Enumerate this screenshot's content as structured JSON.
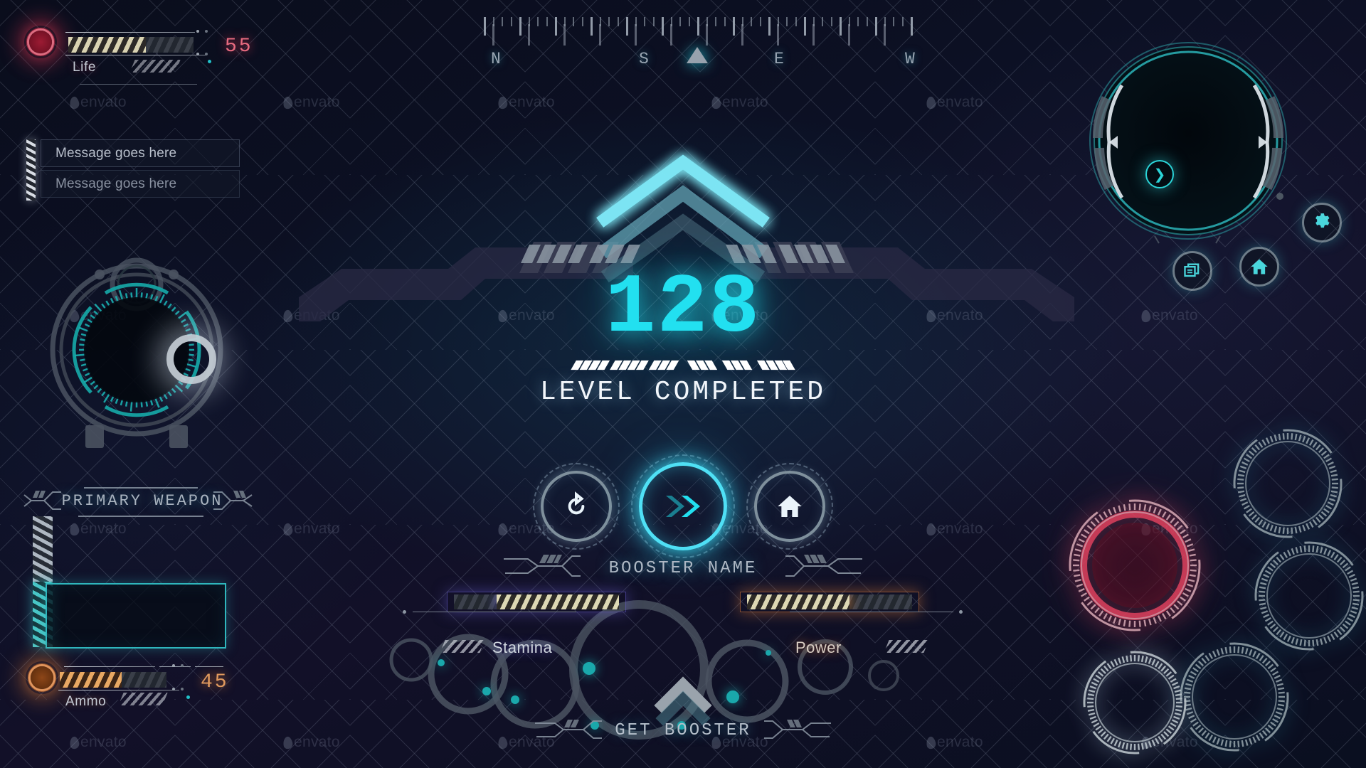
{
  "theme": {
    "bg": "#0a0d1c",
    "cyan": "#22e0f0",
    "teal": "#2fb6bd",
    "red": "#e23a55",
    "orange": "#e2803a",
    "purple": "#6a5fd0",
    "text_light": "#ced6e0",
    "text_dim": "#8b93a2",
    "grey_rim": "#7f909c"
  },
  "life": {
    "label": "Life",
    "value": "55",
    "percent": 62,
    "color": "#e23a55",
    "orb_icon": "life-orb-icon"
  },
  "messages": {
    "items": [
      {
        "text": "Message goes here",
        "state": "active"
      },
      {
        "text": "Message goes here",
        "state": "dim"
      }
    ]
  },
  "compass": {
    "directions": [
      "N",
      "S",
      "E",
      "W"
    ],
    "marker_icon": "compass-heading-marker",
    "tick_count": 49
  },
  "center": {
    "level_number": "128",
    "status_text": "LEVEL  COMPLETED",
    "chevron_icon": "level-up-chevron-icon",
    "number_color": "#22e0f0"
  },
  "actions": {
    "buttons": [
      {
        "name": "restart-button",
        "icon": "restart-icon",
        "label": "Restart",
        "highlighted": false
      },
      {
        "name": "next-button",
        "icon": "double-chevron-icon",
        "label": "Next",
        "highlighted": true
      },
      {
        "name": "home-button",
        "icon": "home-icon",
        "label": "Home",
        "highlighted": false
      }
    ]
  },
  "booster": {
    "title": "BOOSTER  NAME",
    "get_label": "GET  BOOSTER",
    "get_icon": "booster-chevron-icon",
    "stats": [
      {
        "label": "Stamina",
        "percent": 74,
        "color": "#6a5fd0",
        "side": "left"
      },
      {
        "label": "Power",
        "percent": 62,
        "color": "#e2803a",
        "side": "right"
      }
    ]
  },
  "weapon": {
    "title": "PRIMARY  WEAPON",
    "slot_empty": true,
    "ammo": {
      "label": "Ammo",
      "value": "45",
      "percent": 58,
      "color": "#e2803a"
    }
  },
  "radar_left": {
    "name": "tactical-radar-dial",
    "accent": "#1fa6a6",
    "blip_icon": "radar-blip-ring"
  },
  "radar_right": {
    "name": "scanner-radar-dial",
    "accent": "#2bb4b8",
    "expand_icon": "chevron-right-icon"
  },
  "quick_icons": [
    {
      "name": "settings-button",
      "icon": "gear-icon",
      "label": "Settings"
    },
    {
      "name": "home-nav-button",
      "icon": "home-icon",
      "label": "Home"
    },
    {
      "name": "windows-button",
      "icon": "windows-icon",
      "label": "Windows"
    }
  ],
  "decor_rings": {
    "name": "decorative-hud-rings",
    "highlight_color": "#e2425f"
  },
  "watermarks": {
    "text": "envato",
    "count": 10
  }
}
